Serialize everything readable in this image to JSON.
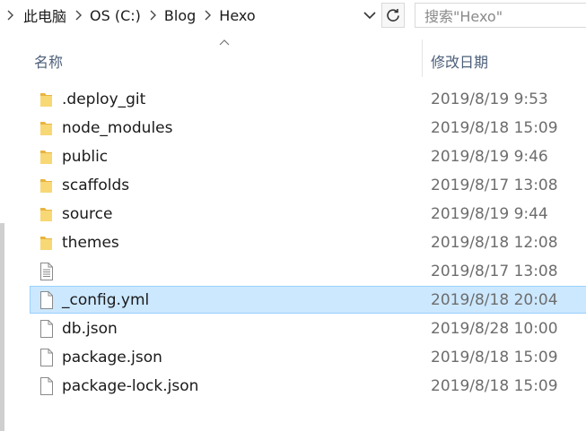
{
  "address": {
    "crumbs": [
      "此电脑",
      "OS (C:)",
      "Blog",
      "Hexo"
    ],
    "separator_icon": "chevron-right-icon",
    "dropdown_icon": "chevron-down-icon",
    "refresh_icon": "refresh-icon"
  },
  "search": {
    "placeholder": "搜索\"Hexo\""
  },
  "columns": {
    "name": "名称",
    "date_modified": "修改日期",
    "sort_icon": "sort-ascending-icon"
  },
  "files": [
    {
      "name": ".deploy_git",
      "date": "2019/8/19 9:53",
      "type": "folder"
    },
    {
      "name": "node_modules",
      "date": "2019/8/18 15:09",
      "type": "folder"
    },
    {
      "name": "public",
      "date": "2019/8/19 9:46",
      "type": "folder"
    },
    {
      "name": "scaffolds",
      "date": "2019/8/17 13:08",
      "type": "folder"
    },
    {
      "name": "source",
      "date": "2019/8/19 9:44",
      "type": "folder"
    },
    {
      "name": "themes",
      "date": "2019/8/18 12:08",
      "type": "folder"
    },
    {
      "name": "",
      "date": "2019/8/17 13:08",
      "type": "text-file"
    },
    {
      "name": "_config.yml",
      "date": "2019/8/18 20:04",
      "type": "file",
      "selected": true
    },
    {
      "name": "db.json",
      "date": "2019/8/28 10:00",
      "type": "file"
    },
    {
      "name": "package.json",
      "date": "2019/8/18 15:09",
      "type": "file"
    },
    {
      "name": "package-lock.json",
      "date": "2019/8/18 15:09",
      "type": "file"
    }
  ],
  "colors": {
    "selection_bg": "#cce8ff",
    "selection_border": "#99d1ff",
    "folder_yellow": "#f8d775",
    "header_text": "#4d607a"
  }
}
